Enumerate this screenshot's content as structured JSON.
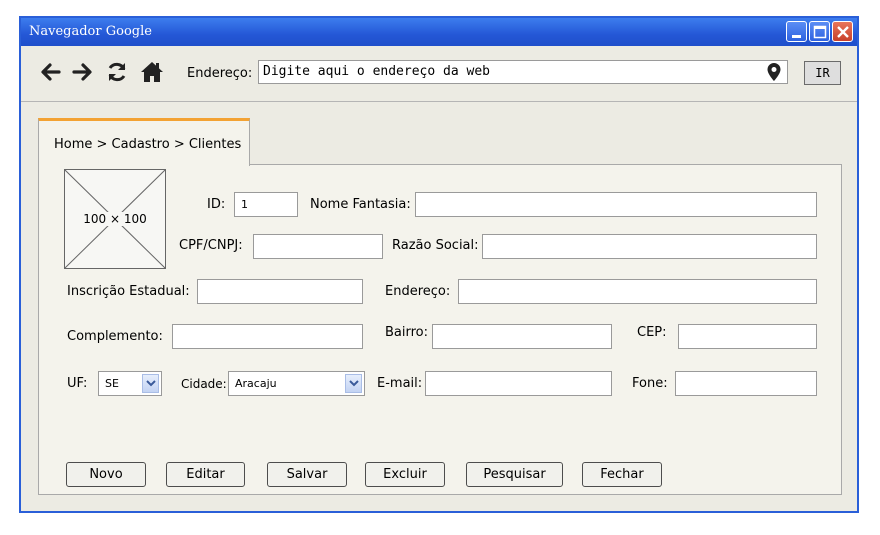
{
  "window": {
    "title": "Navegador Google"
  },
  "toolbar": {
    "address_label": "Endereço:",
    "address_placeholder": "Digite aqui o endereço da web",
    "go_label": "IR"
  },
  "breadcrumb": {
    "text": "Home > Cadastro > Clientes"
  },
  "image_placeholder": {
    "text": "100 × 100"
  },
  "form": {
    "id_label": "ID:",
    "id_value": "1",
    "nome_fantasia_label": "Nome Fantasia:",
    "nome_fantasia_value": "",
    "cpf_cnpj_label": "CPF/CNPJ:",
    "cpf_cnpj_value": "",
    "razao_social_label": "Razão Social:",
    "razao_social_value": "",
    "inscricao_estadual_label": "Inscrição Estadual:",
    "inscricao_estadual_value": "",
    "endereco_label": "Endereço:",
    "endereco_value": "",
    "complemento_label": "Complemento:",
    "complemento_value": "",
    "bairro_label": "Bairro:",
    "bairro_value": "",
    "cep_label": "CEP:",
    "cep_value": "",
    "uf_label": "UF:",
    "uf_value": "SE",
    "cidade_label": "Cidade:",
    "cidade_value": "Aracaju",
    "email_label": "E-mail:",
    "email_value": "",
    "fone_label": "Fone:",
    "fone_value": ""
  },
  "buttons": {
    "novo": "Novo",
    "editar": "Editar",
    "salvar": "Salvar",
    "excluir": "Excluir",
    "pesquisar": "Pesquisar",
    "fechar": "Fechar"
  },
  "icons": {
    "back": "arrow-left-icon",
    "forward": "arrow-right-icon",
    "refresh": "refresh-icon",
    "home": "home-icon",
    "location": "map-pin-icon",
    "minimize": "minimize-icon",
    "maximize": "maximize-icon",
    "close": "close-icon"
  },
  "colors": {
    "titlebar": "#2457d6",
    "window_border": "#2a5fd8",
    "tab_accent": "#f3a233",
    "background": "#ecebe3"
  }
}
